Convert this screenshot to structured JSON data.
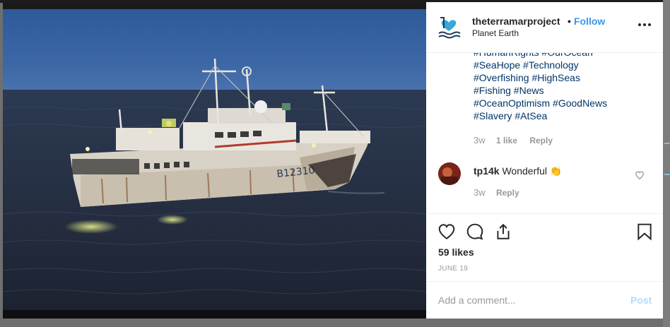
{
  "post": {
    "username": "theterramarproject",
    "separator": "•",
    "follow_label": "Follow",
    "location": "Planet Earth",
    "image_icon": "fishing-vessel-photo"
  },
  "caption": {
    "hashtag_lines": [
      "#HumanRights #OurOcean",
      "#SeaHope #Technology",
      "#Overfishing #HighSeas",
      "#Fishing #News",
      "#OceanOptimism #GoodNews",
      "#Slavery #AtSea"
    ],
    "age": "3w",
    "likes": "1 like",
    "reply_label": "Reply"
  },
  "comment": {
    "username": "tp14k",
    "text": "Wonderful",
    "emoji": "👏",
    "age": "3w",
    "reply_label": "Reply"
  },
  "actions": {
    "likes_count": "59 likes",
    "date": "JUNE 19"
  },
  "comment_box": {
    "placeholder": "Add a comment...",
    "post_label": "Post"
  },
  "colors": {
    "link": "#003569",
    "follow": "#3897f0",
    "muted": "#999999",
    "post_disabled": "#b3dbff"
  }
}
